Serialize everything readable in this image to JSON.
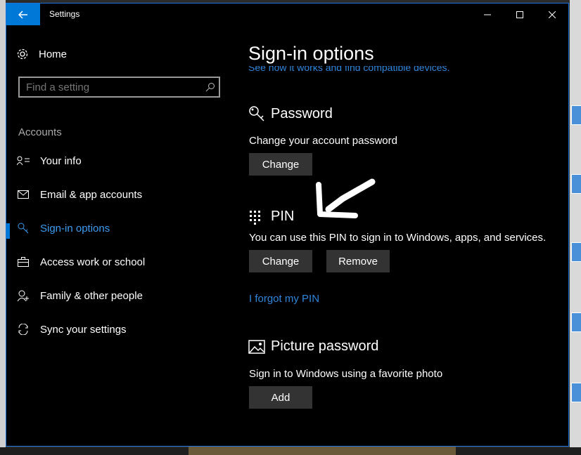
{
  "window": {
    "title": "Settings"
  },
  "sidebar": {
    "home_label": "Home",
    "search_placeholder": "Find a setting",
    "section_label": "Accounts",
    "items": [
      {
        "label": "Your info",
        "icon": "person-card-icon"
      },
      {
        "label": "Email & app accounts",
        "icon": "mail-icon"
      },
      {
        "label": "Sign-in options",
        "icon": "key-icon",
        "active": true
      },
      {
        "label": "Access work or school",
        "icon": "briefcase-icon"
      },
      {
        "label": "Family & other people",
        "icon": "person-add-icon"
      },
      {
        "label": "Sync your settings",
        "icon": "sync-icon"
      }
    ]
  },
  "main": {
    "title": "Sign-in options",
    "partial_link": "See how it works and find compatible devices.",
    "password": {
      "heading": "Password",
      "description": "Change your account password",
      "change_label": "Change"
    },
    "pin": {
      "heading": "PIN",
      "description": "You can use this PIN to sign in to Windows, apps, and services.",
      "change_label": "Change",
      "remove_label": "Remove",
      "forgot_link": "I forgot my PIN"
    },
    "picture_password": {
      "heading": "Picture password",
      "description": "Sign in to Windows using a favorite photo",
      "add_label": "Add"
    }
  },
  "colors": {
    "accent": "#0078d7",
    "link": "#2f86dd",
    "button_bg": "#333333",
    "background": "#000000"
  }
}
